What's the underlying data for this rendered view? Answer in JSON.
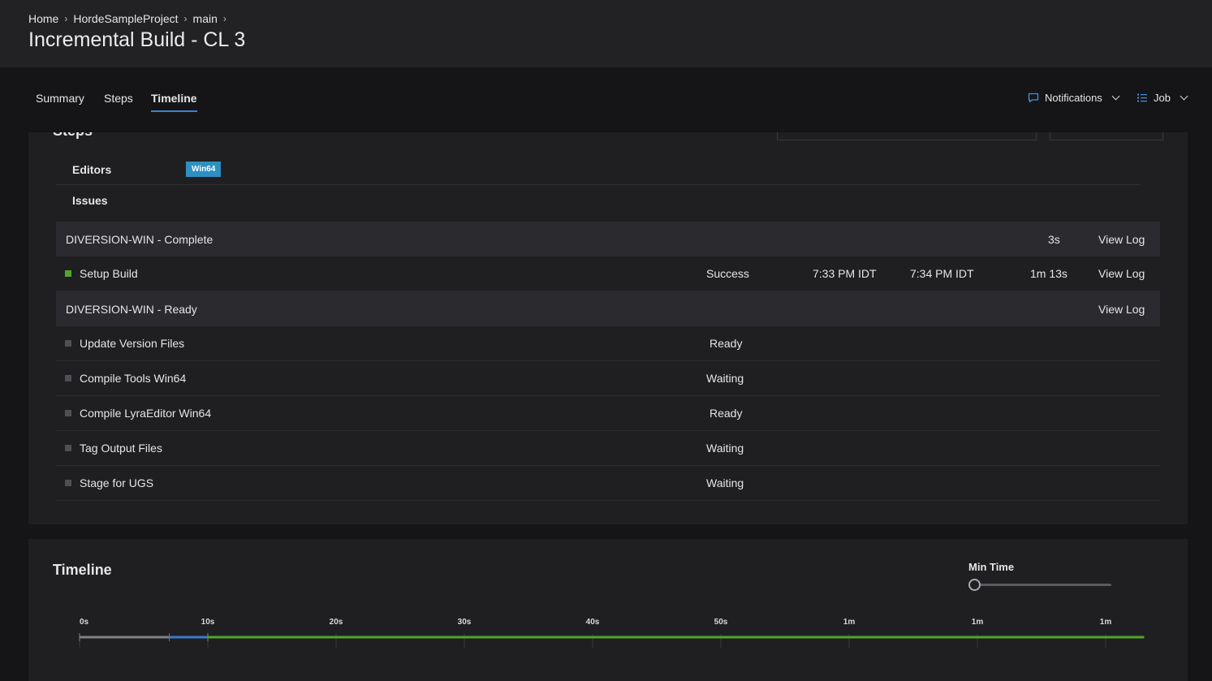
{
  "breadcrumb": {
    "items": [
      "Home",
      "HordeSampleProject",
      "main"
    ],
    "sep": "›"
  },
  "title": "Incremental Build - CL 3",
  "tabs": [
    "Summary",
    "Steps",
    "Timeline"
  ],
  "active_tab": "Timeline",
  "nav_right": {
    "notifications": "Notifications",
    "job": "Job"
  },
  "steps": {
    "heading": "Steps",
    "meta": [
      {
        "label": "Editors",
        "badge": "Win64"
      },
      {
        "label": "Issues"
      }
    ],
    "groups": [
      {
        "name": "DIVERSION-WIN - Complete",
        "duration": "3s",
        "view_log": "View Log"
      },
      {
        "name": "DIVERSION-WIN - Ready",
        "view_log": "View Log"
      }
    ],
    "setup": {
      "name": "Setup Build",
      "state": "Success",
      "start": "7:33 PM IDT",
      "end": "7:34 PM IDT",
      "duration": "1m 13s",
      "view_log": "View Log"
    },
    "pending": [
      {
        "name": "Update Version Files",
        "state": "Ready"
      },
      {
        "name": "Compile Tools Win64",
        "state": "Waiting"
      },
      {
        "name": "Compile LyraEditor Win64",
        "state": "Ready"
      },
      {
        "name": "Tag Output Files",
        "state": "Waiting"
      },
      {
        "name": "Stage for UGS",
        "state": "Waiting"
      }
    ]
  },
  "timeline": {
    "title": "Timeline",
    "min_time_label": "Min Time",
    "min_time_value": 0,
    "ticks": [
      "0s",
      "10s",
      "20s",
      "30s",
      "40s",
      "50s",
      "1m",
      "1m",
      "1m"
    ],
    "tick_seconds": [
      0,
      10,
      20,
      30,
      40,
      50,
      60,
      70,
      80
    ],
    "segments": [
      {
        "start": 0,
        "end": 7,
        "color": "#808085"
      },
      {
        "start": 7,
        "end": 10,
        "color": "#3a7bd0"
      },
      {
        "start": 10,
        "end": 83,
        "color": "#52a52a"
      }
    ]
  }
}
